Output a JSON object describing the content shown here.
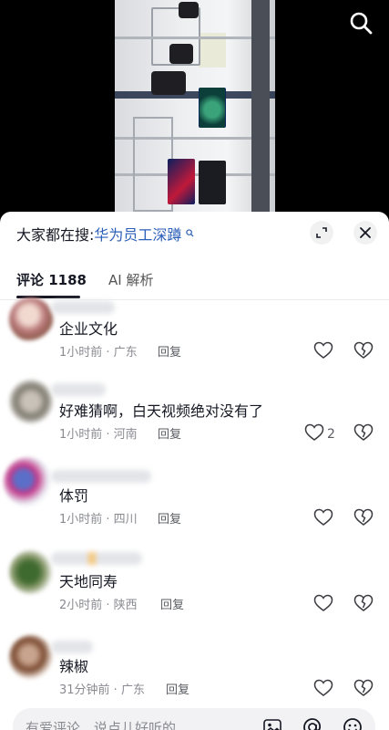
{
  "video": {
    "search_icon": "search-icon"
  },
  "sheet": {
    "search_prefix": "大家都在搜:",
    "search_keyword": "华为员工深蹲",
    "search_keyword_icon": "small-search-icon",
    "expand_icon": "expand-icon",
    "close_icon": "close-icon"
  },
  "tabs": [
    {
      "label": "评论 1188",
      "active": true
    },
    {
      "label": "AI 解析",
      "active": false
    }
  ],
  "comments": [
    {
      "text": "企业文化",
      "meta": "1小时前 · 广东",
      "reply": "回复",
      "likes": ""
    },
    {
      "text": "好难猜啊，白天视频绝对没有了",
      "meta": "1小时前 · 河南",
      "reply": "回复",
      "likes": "2"
    },
    {
      "text": "体罚",
      "meta": "1小时前 · 四川",
      "reply": "回复",
      "likes": ""
    },
    {
      "text": "天地同寿",
      "meta": "2小时前 · 陕西",
      "reply": "回复",
      "likes": ""
    },
    {
      "text": "辣椒",
      "meta": "31分钟前 · 广东",
      "reply": "回复",
      "likes": ""
    }
  ],
  "input": {
    "placeholder": "有爱评论，说点儿好听的",
    "icons": [
      "image-icon",
      "at-icon",
      "emoji-icon"
    ]
  }
}
